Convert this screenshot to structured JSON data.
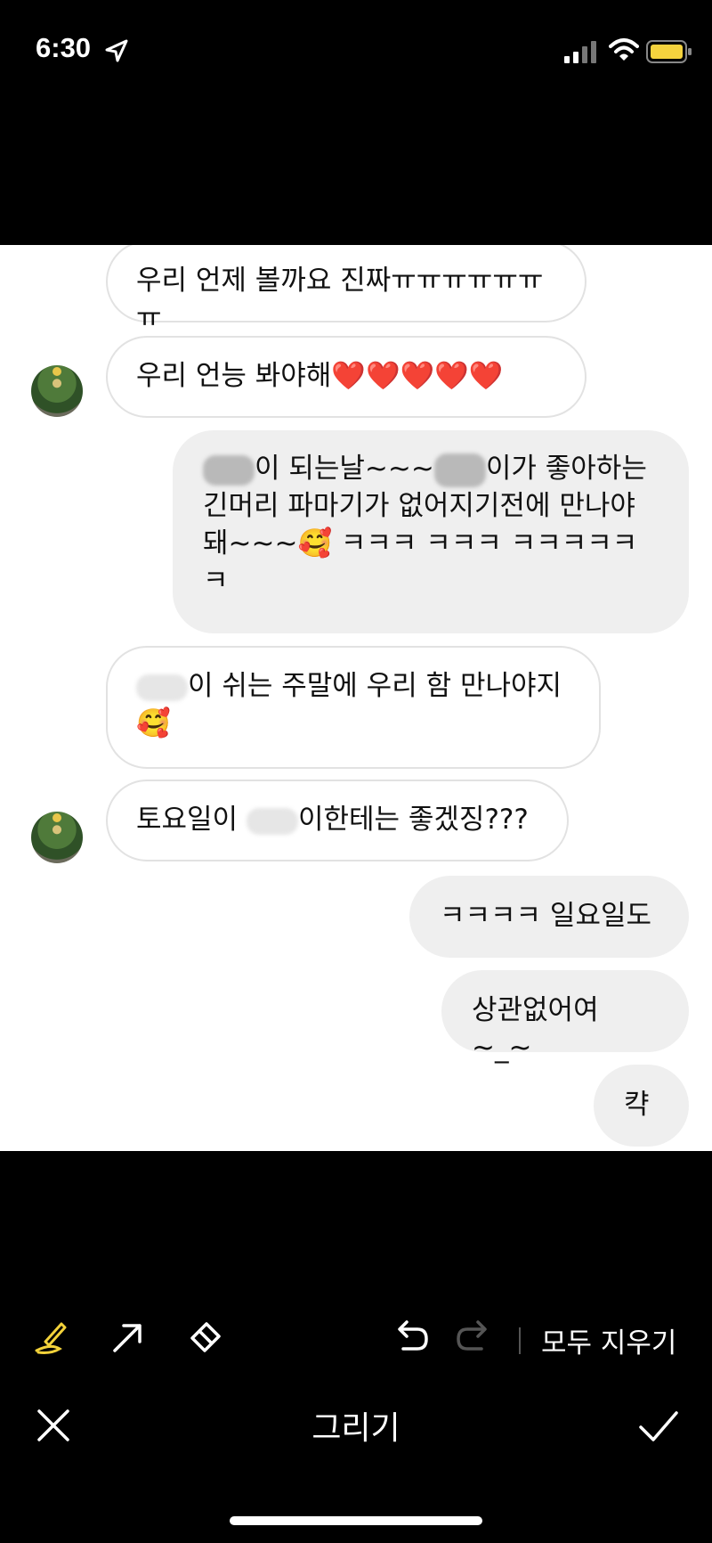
{
  "status_bar": {
    "time": "6:30",
    "icons": [
      "location-arrow-icon",
      "cellular-signal-icon",
      "wifi-icon",
      "battery-icon"
    ],
    "battery_color": "#f5d33e"
  },
  "messages": [
    {
      "direction": "incoming",
      "lines": [
        "우리 언제 볼까요 진짜ㅠㅠㅠㅠㅠㅠㅠ"
      ]
    },
    {
      "direction": "incoming",
      "lines": [
        "우리 언능 봐야해❤️❤️❤️❤️❤️"
      ],
      "has_avatar": true
    },
    {
      "direction": "outgoing",
      "lines": [
        "이 되는날~~~",
        "이가 좋아하는",
        "긴머리 파마기가 없어지기전에 만나야",
        "돼~~~🥰 ㅋㅋㅋ ㅋㅋㅋ ㅋㅋㅋㅋㅋ",
        "ㅋ"
      ]
    },
    {
      "direction": "incoming",
      "lines": [
        "이 쉬는 주말에 우리 함 만나야지",
        "🥰"
      ]
    },
    {
      "direction": "incoming",
      "lines": [
        "토요일이",
        "이한테는 좋겠징???"
      ],
      "has_avatar": true
    },
    {
      "direction": "outgoing",
      "lines": [
        "ㅋㅋㅋㅋ 일요일도"
      ]
    },
    {
      "direction": "outgoing",
      "lines": [
        "상관없어여~_~"
      ]
    },
    {
      "direction": "outgoing",
      "lines": [
        "캭"
      ]
    }
  ],
  "toolbar": {
    "tools": [
      "pen-icon",
      "arrow-icon",
      "eraser-icon",
      "undo-icon",
      "redo-icon"
    ],
    "active_tool_color": "#f3d23a",
    "clear_all_label": "모두 지우기"
  },
  "bottom_bar": {
    "close_icon": "close-icon",
    "title": "그리기",
    "done_icon": "checkmark-icon"
  }
}
